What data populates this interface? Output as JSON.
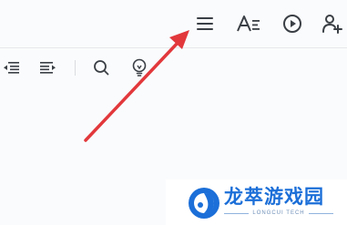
{
  "top_bar": {
    "icons": [
      "menu-icon",
      "text-format-icon",
      "play-circle-icon",
      "add-user-icon"
    ]
  },
  "toolbar": {
    "icons": [
      "outdent-icon",
      "indent-icon",
      "search-icon",
      "lightbulb-icon"
    ]
  },
  "watermark": {
    "title": "龙萃游戏园",
    "subtitle": "LONGCUI TECH"
  },
  "colors": {
    "icon": "#3a3f45",
    "arrow": "#e2383c",
    "brand": "#1c6fd8"
  }
}
